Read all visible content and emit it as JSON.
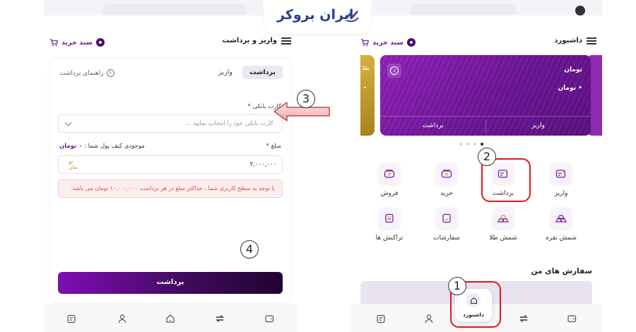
{
  "logo": {
    "text": "ایران بروکر"
  },
  "left_screen": {
    "title": "واریز و برداشت",
    "cart_label": "سبد خرید",
    "tabs": [
      {
        "label": "برداشت",
        "active": true
      },
      {
        "label": "واریز",
        "active": false
      }
    ],
    "guide_label": "راهنمای برداشت",
    "bank_card_label": "کارت بانکی *",
    "bank_card_placeholder": "کارت بانکی خود را انتخاب نمایید ...",
    "amount_label": "مبلغ *",
    "wallet_balance_label": "موجودی کیف پول شما :",
    "wallet_balance_value": "۰ تومان",
    "amount_value": "۲,۰۰۰,۰۰۰",
    "currency_mark": "تو\nمان",
    "alert_text": "با توجه به سطح کاربری شما ، حداکثر مبلغ در هر برداشت ۱۰,۰۰۰,۰۰۰ تومان می باشد.",
    "submit_label": "برداشت"
  },
  "right_screen": {
    "title": "داشبورد",
    "cart_label": "سبد خرید",
    "card": {
      "line1": "تومان",
      "line2": "• تومان",
      "withdraw": "برداشت",
      "deposit": "واریز"
    },
    "gold_card_edge_text": "طلا",
    "carousel": {
      "count": 4,
      "active_index": 3
    },
    "grid": [
      {
        "label": "واریز",
        "icon": "wallet-in-icon"
      },
      {
        "label": "برداشت",
        "icon": "wallet-out-icon"
      },
      {
        "label": "خرید",
        "icon": "purchase-icon"
      },
      {
        "label": "فروش",
        "icon": "sell-icon"
      },
      {
        "label": "شمش نقره",
        "icon": "silver-bar-icon"
      },
      {
        "label": "شمش طلا",
        "icon": "gold-bar-icon"
      },
      {
        "label": "سفارشات",
        "icon": "orders-icon"
      },
      {
        "label": "تراکنش ها",
        "icon": "transactions-icon"
      }
    ],
    "orders_title": "سفارش های من",
    "nav_home_label": "داشبورد"
  },
  "callouts": [
    "1",
    "2",
    "3",
    "4"
  ],
  "colors": {
    "brand_purple": "#6b1594",
    "brand_dark": "#4a0d6b",
    "alert_bg": "#fdeeee",
    "alert_text": "#d34a4f",
    "callout_ring": "#e01818",
    "gold": "#c9a23a",
    "logo_blue": "#2d3f8f"
  }
}
